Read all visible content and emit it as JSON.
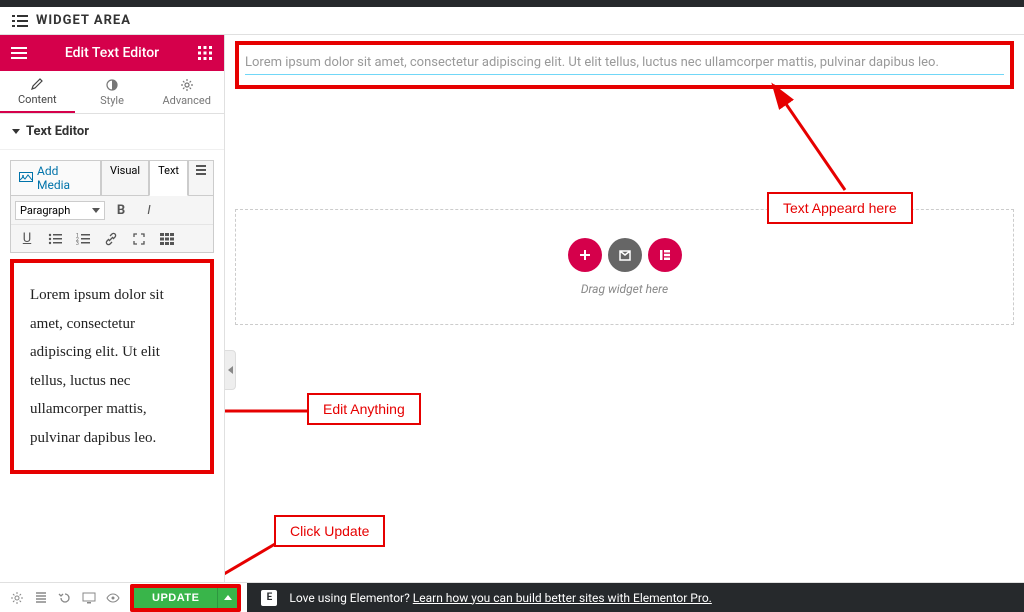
{
  "top_bar_title": "WIDGET AREA",
  "sidebar": {
    "title": "Edit Text Editor",
    "tabs": [
      {
        "label": "Content"
      },
      {
        "label": "Style"
      },
      {
        "label": "Advanced"
      }
    ],
    "section_title": "Text Editor",
    "add_media_label": "Add Media",
    "mode_tabs": {
      "visual": "Visual",
      "text": "Text"
    },
    "paragraph_select": "Paragraph",
    "content": "Lorem ipsum dolor sit amet, consectetur adipiscing elit. Ut elit tellus, luctus nec ullamcorper mattis, pulvinar dapibus leo."
  },
  "canvas": {
    "output_text": "Lorem ipsum dolor sit amet, consectetur adipiscing elit. Ut elit tellus, luctus nec ullamcorper mattis, pulvinar dapibus leo.",
    "drop_label": "Drag widget here"
  },
  "annotations": {
    "text_appears": "Text Appeard here",
    "edit_anything": "Edit Anything",
    "click_update": "Click Update"
  },
  "footer": {
    "update_label": "UPDATE",
    "promo_prefix": "Love using Elementor? ",
    "promo_link": "Learn how you can build better sites with Elementor Pro."
  }
}
